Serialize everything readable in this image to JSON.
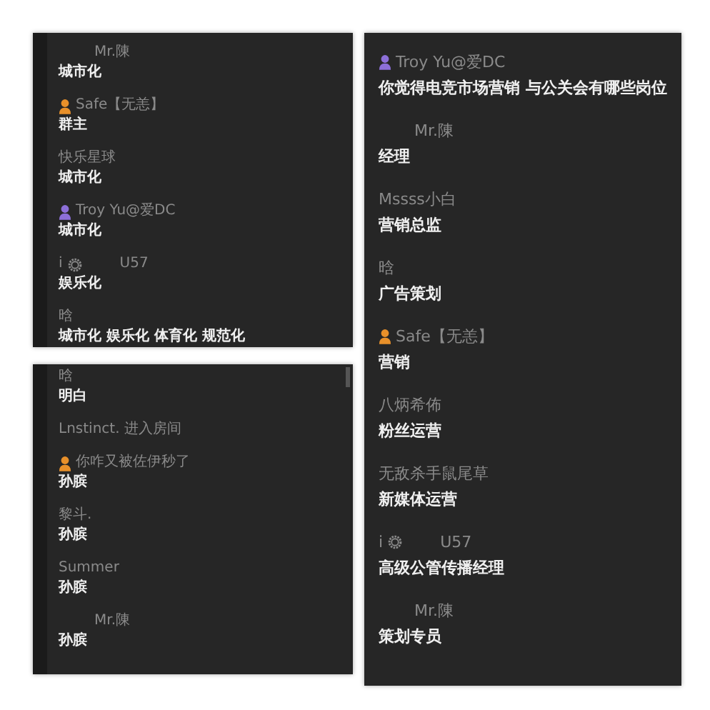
{
  "panels": [
    {
      "messages": [
        {
          "kind": "blank",
          "sender": "Mr.陳",
          "text": "城市化"
        },
        {
          "kind": "orange-person",
          "sender": "Safe【无恙】",
          "text": "群主"
        },
        {
          "sender": "快乐星球",
          "text": "城市化"
        },
        {
          "kind": "purple-person",
          "sender": "Troy Yu@爱DC",
          "text": "城市化"
        },
        {
          "kind": "gear",
          "prefix": "i",
          "sender": "U57",
          "text": "娱乐化"
        },
        {
          "sender": "晗",
          "text": "城市化 娱乐化 体育化 规范化"
        }
      ]
    },
    {
      "messages": [
        {
          "sender": "晗",
          "text": "明白"
        },
        {
          "sender": "Lnstinct. 进入房间"
        },
        {
          "kind": "orange-person",
          "sender": "你咋又被佐伊秒了",
          "text": "孙膑"
        },
        {
          "sender": "黎斗.",
          "text": "孙膑"
        },
        {
          "sender": "Summer",
          "text": "孙膑"
        },
        {
          "kind": "blank",
          "sender": "Mr.陳",
          "text": "孙膑"
        }
      ]
    },
    {
      "messages": [
        {
          "kind": "purple-person",
          "sender": "Troy Yu@爱DC",
          "text": "你觉得电竞市场营销 与公关会有哪些岗位"
        },
        {
          "kind": "blank",
          "sender": "Mr.陳",
          "text": "经理"
        },
        {
          "sender": "Mssss小白",
          "text": "营销总监"
        },
        {
          "sender": "晗",
          "text": "广告策划"
        },
        {
          "kind": "orange-person",
          "sender": "Safe【无恙】",
          "text": "营销"
        },
        {
          "sender": "八炳希佈",
          "text": "粉丝运营"
        },
        {
          "sender": "无敌杀手鼠尾草",
          "text": "新媒体运营"
        },
        {
          "kind": "gear",
          "prefix": "i",
          "sender": "U57",
          "text": "高级公管传播经理"
        },
        {
          "kind": "blank",
          "sender": "Mr.陳",
          "text": "策划专员"
        }
      ]
    }
  ]
}
